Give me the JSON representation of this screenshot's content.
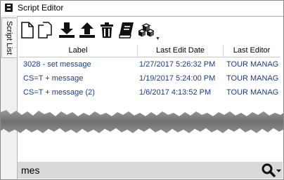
{
  "window": {
    "title": "Script Editor"
  },
  "side_tab": {
    "label": "Script List"
  },
  "toolbar": {
    "buttons": [
      {
        "name": "new-script-button",
        "icon": "new-document-icon"
      },
      {
        "name": "copy-button",
        "icon": "copy-icon"
      },
      {
        "name": "download-button",
        "icon": "download-icon"
      },
      {
        "name": "upload-button",
        "icon": "upload-icon"
      },
      {
        "name": "delete-button",
        "icon": "trash-icon"
      },
      {
        "name": "library-button",
        "icon": "book-icon"
      },
      {
        "name": "objects-button",
        "icon": "cubes-icon"
      }
    ]
  },
  "grid": {
    "columns": [
      "Label",
      "Last Edit Date",
      "Last Editor"
    ],
    "rows": [
      {
        "label": "3028 - set message",
        "date": "1/27/2017 5:26:32 PM",
        "editor": "TOUR MANAG"
      },
      {
        "label": "CS=T + message",
        "date": "1/19/2017 5:24:00 PM",
        "editor": "TOUR MANAG"
      },
      {
        "label": "CS=T + message (2)",
        "date": "1/6/2017 4:13:52 PM",
        "editor": "TOUR MANAG"
      }
    ]
  },
  "search": {
    "value": "mes",
    "icon": "search-dropdown-icon"
  },
  "colors": {
    "link_text": "#1b3c8a",
    "search_bar": "#d9d9d9"
  }
}
